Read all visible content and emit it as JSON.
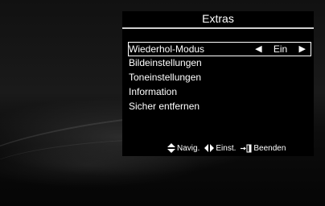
{
  "menu": {
    "title": "Extras",
    "items": [
      {
        "label": "Wiederhol-Modus",
        "value": "Ein",
        "selected": true
      },
      {
        "label": "Bildeinstellungen"
      },
      {
        "label": "Toneinstellungen"
      },
      {
        "label": "Information"
      },
      {
        "label": "Sicher entfernen"
      }
    ]
  },
  "footer": {
    "navigate": "Navig.",
    "adjust": "Einst.",
    "exit": "Beenden"
  },
  "icons": {
    "navigate": "up-down-arrows-icon",
    "adjust": "left-right-arrows-icon",
    "exit": "exit-icon",
    "prev": "left-triangle-icon",
    "next": "right-triangle-icon"
  },
  "colors": {
    "background": "#000000",
    "text": "#ffffff",
    "selection_border": "#ffffff"
  }
}
